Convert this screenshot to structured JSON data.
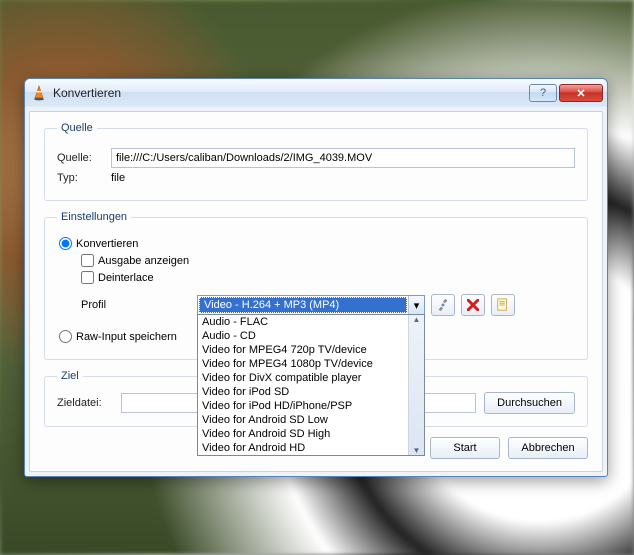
{
  "window": {
    "title": "Konvertieren"
  },
  "quelle": {
    "legend": "Quelle",
    "source_label": "Quelle:",
    "source_value": "file:///C:/Users/caliban/Downloads/2/IMG_4039.MOV",
    "type_label": "Typ:",
    "type_value": "file"
  },
  "einstellungen": {
    "legend": "Einstellungen",
    "convert_label": "Konvertieren",
    "show_output_label": "Ausgabe anzeigen",
    "deinterlace_label": "Deinterlace",
    "profil_label": "Profil",
    "profil_selected": "Video - H.264 + MP3 (MP4)",
    "profil_options": [
      "Audio - FLAC",
      "Audio - CD",
      "Video for MPEG4 720p TV/device",
      "Video for MPEG4 1080p TV/device",
      "Video for DivX compatible player",
      "Video for iPod SD",
      "Video for iPod HD/iPhone/PSP",
      "Video for Android SD Low",
      "Video for Android SD High",
      "Video for Android HD"
    ],
    "raw_label": "Raw-Input speichern"
  },
  "ziel": {
    "legend": "Ziel",
    "target_label": "Zieldatei:",
    "target_value": "",
    "browse_label": "Durchsuchen"
  },
  "buttons": {
    "start": "Start",
    "cancel": "Abbrechen"
  },
  "icons": {
    "help": "?",
    "close": "✕",
    "tools": "tools-icon",
    "delete": "delete-icon",
    "new": "new-profile-icon",
    "dropdown": "▾"
  }
}
